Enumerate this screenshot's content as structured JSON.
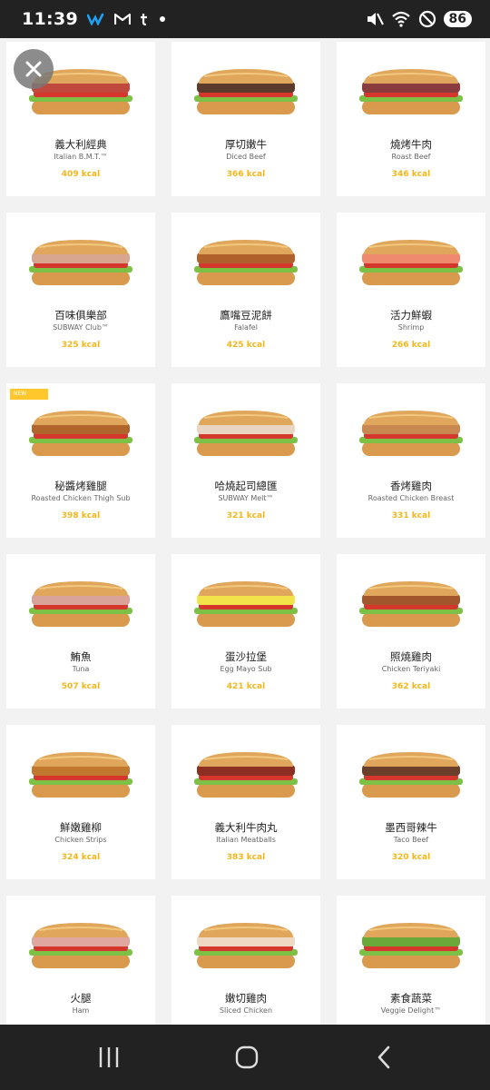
{
  "status_bar": {
    "time": "11:39",
    "battery": "86",
    "left_icons": [
      "w-app-icon",
      "mail-icon",
      "t-app-icon",
      "dot-icon"
    ],
    "right_icons": [
      "mute-icon",
      "wifi-icon",
      "dnd-icon"
    ]
  },
  "close_button": {
    "icon": "close-icon"
  },
  "items": [
    {
      "zh": "義大利經典",
      "en": "Italian B.M.T.™",
      "kcal": "409 kcal",
      "fill": "#c0483c",
      "badge": ""
    },
    {
      "zh": "厚切嫩牛",
      "en": "Diced Beef",
      "kcal": "366 kcal",
      "fill": "#5a3a2a",
      "badge": ""
    },
    {
      "zh": "燒烤牛肉",
      "en": "Roast Beef",
      "kcal": "346 kcal",
      "fill": "#8a3b3e",
      "badge": ""
    },
    {
      "zh": "百味俱樂部",
      "en": "SUBWAY Club™",
      "kcal": "325 kcal",
      "fill": "#d8a58f",
      "badge": ""
    },
    {
      "zh": "鷹嘴豆泥餅",
      "en": "Falafel",
      "kcal": "425 kcal",
      "fill": "#b0602a",
      "badge": ""
    },
    {
      "zh": "活力鮮蝦",
      "en": "Shrimp",
      "kcal": "266 kcal",
      "fill": "#f08a6e",
      "badge": ""
    },
    {
      "zh": "秘醬烤雞腿",
      "en": "Roasted Chicken Thigh Sub",
      "kcal": "398 kcal",
      "fill": "#b0652c",
      "badge": "NEW"
    },
    {
      "zh": "哈燒起司總匯",
      "en": "SUBWAY Melt™",
      "kcal": "321 kcal",
      "fill": "#e8d6c2",
      "badge": ""
    },
    {
      "zh": "香烤雞肉",
      "en": "Roasted Chicken Breast",
      "kcal": "331 kcal",
      "fill": "#c98850",
      "badge": ""
    },
    {
      "zh": "鮪魚",
      "en": "Tuna",
      "kcal": "507 kcal",
      "fill": "#d9a39a",
      "badge": ""
    },
    {
      "zh": "蛋沙拉堡",
      "en": "Egg Mayo Sub",
      "kcal": "421 kcal",
      "fill": "#f3e34a",
      "badge": ""
    },
    {
      "zh": "照燒雞肉",
      "en": "Chicken Teriyaki",
      "kcal": "362 kcal",
      "fill": "#a2562c",
      "badge": ""
    },
    {
      "zh": "鮮嫩雞柳",
      "en": "Chicken Strips",
      "kcal": "324 kcal",
      "fill": "#c2772f",
      "badge": ""
    },
    {
      "zh": "義大利牛肉丸",
      "en": "Italian Meatballs",
      "kcal": "383 kcal",
      "fill": "#8c2e22",
      "badge": ""
    },
    {
      "zh": "墨西哥辣牛",
      "en": "Taco Beef",
      "kcal": "320 kcal",
      "fill": "#6a3e28",
      "badge": ""
    },
    {
      "zh": "火腿",
      "en": "Ham",
      "kcal": "",
      "fill": "#e0a7a0",
      "badge": ""
    },
    {
      "zh": "嫩切雞肉",
      "en": "Sliced Chicken",
      "kcal": "",
      "fill": "#f0d9c4",
      "badge": ""
    },
    {
      "zh": "素食蔬菜",
      "en": "Veggie Delight™",
      "kcal": "",
      "fill": "#6aa83a",
      "badge": ""
    }
  ],
  "nav_bar": {
    "recent": "recent-apps-icon",
    "home": "home-icon",
    "back": "back-icon"
  }
}
